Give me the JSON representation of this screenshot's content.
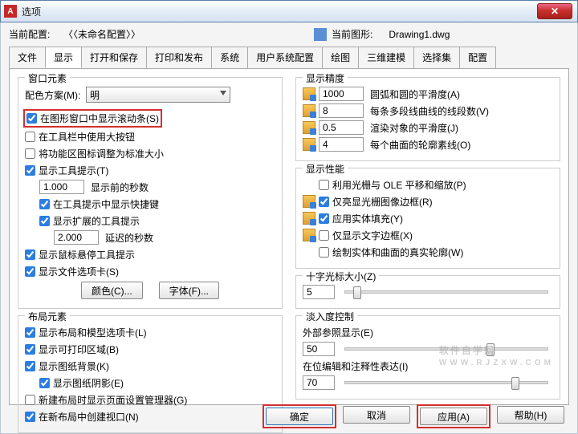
{
  "window": {
    "icon_letter": "A",
    "title": "选项",
    "close": "✕"
  },
  "header": {
    "current_profile_label": "当前配置:",
    "current_profile_value": "〈〈未命名配置〉〉",
    "current_drawing_label": "当前图形:",
    "current_drawing_value": "Drawing1.dwg"
  },
  "tabs": [
    "文件",
    "显示",
    "打开和保存",
    "打印和发布",
    "系统",
    "用户系统配置",
    "绘图",
    "三维建模",
    "选择集",
    "配置"
  ],
  "active_tab": 1,
  "left": {
    "window_elements": {
      "legend": "窗口元素",
      "color_scheme_label": "配色方案(M):",
      "color_scheme_value": "明",
      "cb_scrollbars": "在图形窗口中显示滚动条(S)",
      "cb_large_buttons": "在工具栏中使用大按钮",
      "cb_std_icon_size": "将功能区图标调整为标准大小",
      "cb_tooltips": "显示工具提示(T)",
      "tip_delay_value": "1.000",
      "tip_delay_label": "显示前的秒数",
      "cb_shortcut_in_tip": "在工具提示中显示快捷键",
      "cb_ext_tip": "显示扩展的工具提示",
      "ext_delay_value": "2.000",
      "ext_delay_label": "延迟的秒数",
      "cb_hover_tip": "显示鼠标悬停工具提示",
      "cb_file_tabs": "显示文件选项卡(S)",
      "btn_colors": "颜色(C)...",
      "btn_fonts": "字体(F)..."
    },
    "layout_elements": {
      "legend": "布局元素",
      "cb_layout_tabs": "显示布局和模型选项卡(L)",
      "cb_printable": "显示可打印区域(B)",
      "cb_paper_bg": "显示图纸背景(K)",
      "cb_paper_shadow": "显示图纸阴影(E)",
      "cb_new_page_setup": "新建布局时显示页面设置管理器(G)",
      "cb_new_viewport": "在新布局中创建视口(N)"
    }
  },
  "right": {
    "precision": {
      "legend": "显示精度",
      "v1": "1000",
      "l1": "圆弧和圆的平滑度(A)",
      "v2": "8",
      "l2": "每条多段线曲线的线段数(V)",
      "v3": "0.5",
      "l3": "渲染对象的平滑度(J)",
      "v4": "4",
      "l4": "每个曲面的轮廓素线(O)"
    },
    "performance": {
      "legend": "显示性能",
      "cb_raster": "利用光栅与 OLE 平移和缩放(P)",
      "cb_highlight_frame": "仅亮显光栅图像边框(R)",
      "cb_solid_fill": "应用实体填充(Y)",
      "cb_text_frame": "仅显示文字边框(X)",
      "cb_true_silh": "绘制实体和曲面的真实轮廓(W)"
    },
    "crosshair": {
      "legend": "十字光标大小(Z)",
      "value": "5"
    },
    "fade": {
      "legend": "淡入度控制",
      "xref_label": "外部参照显示(E)",
      "xref_value": "50",
      "inplace_label": "在位编辑和注释性表达(I)",
      "inplace_value": "70"
    }
  },
  "footer": {
    "ok": "确定",
    "cancel": "取消",
    "apply": "应用(A)",
    "help": "帮助(H)"
  },
  "watermark": {
    "main": "软件自学网",
    "sub": "WWW.RJZXW.COM"
  }
}
